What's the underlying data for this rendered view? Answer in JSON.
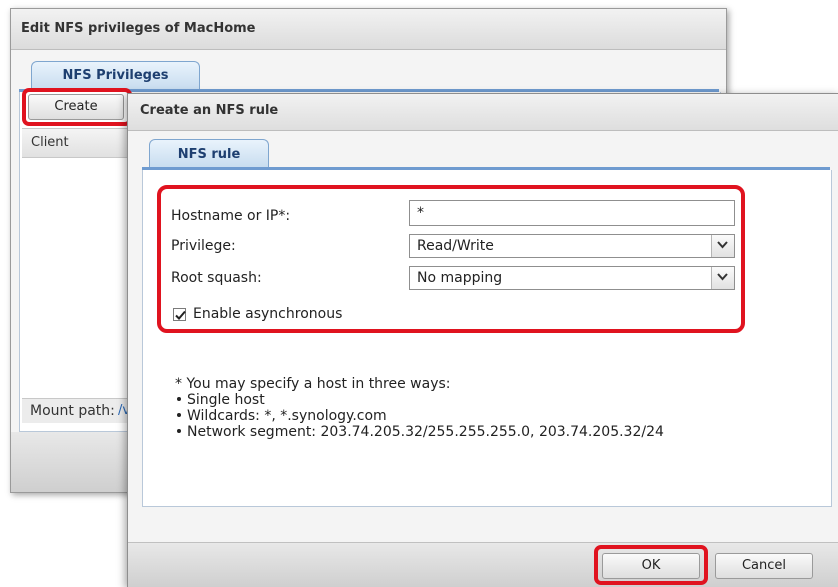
{
  "back_dialog": {
    "title": "Edit NFS privileges of MacHome",
    "tab_label": "NFS Privileges",
    "create_label": "Create",
    "client_header": "Client",
    "mount_path_label": "Mount path:",
    "mount_path_value": "/v"
  },
  "front_dialog": {
    "title": "Create an NFS rule",
    "tab_label": "NFS rule",
    "form": {
      "hostname_label": "Hostname or IP*:",
      "hostname_value": "*",
      "privilege_label": "Privilege:",
      "privilege_value": "Read/Write",
      "root_squash_label": "Root squash:",
      "root_squash_value": "No mapping",
      "async_label": "Enable asynchronous",
      "async_checked": true
    },
    "notes": {
      "intro": "* You may specify a host in three ways:",
      "items": [
        "Single host",
        "Wildcards: *, *.synology.com",
        "Network segment: 203.74.205.32/255.255.255.0, 203.74.205.32/24"
      ]
    },
    "ok_label": "OK",
    "cancel_label": "Cancel"
  },
  "colors": {
    "highlight": "#e0131f",
    "tab_accent": "#6f9bd0",
    "link": "#2867b5"
  }
}
